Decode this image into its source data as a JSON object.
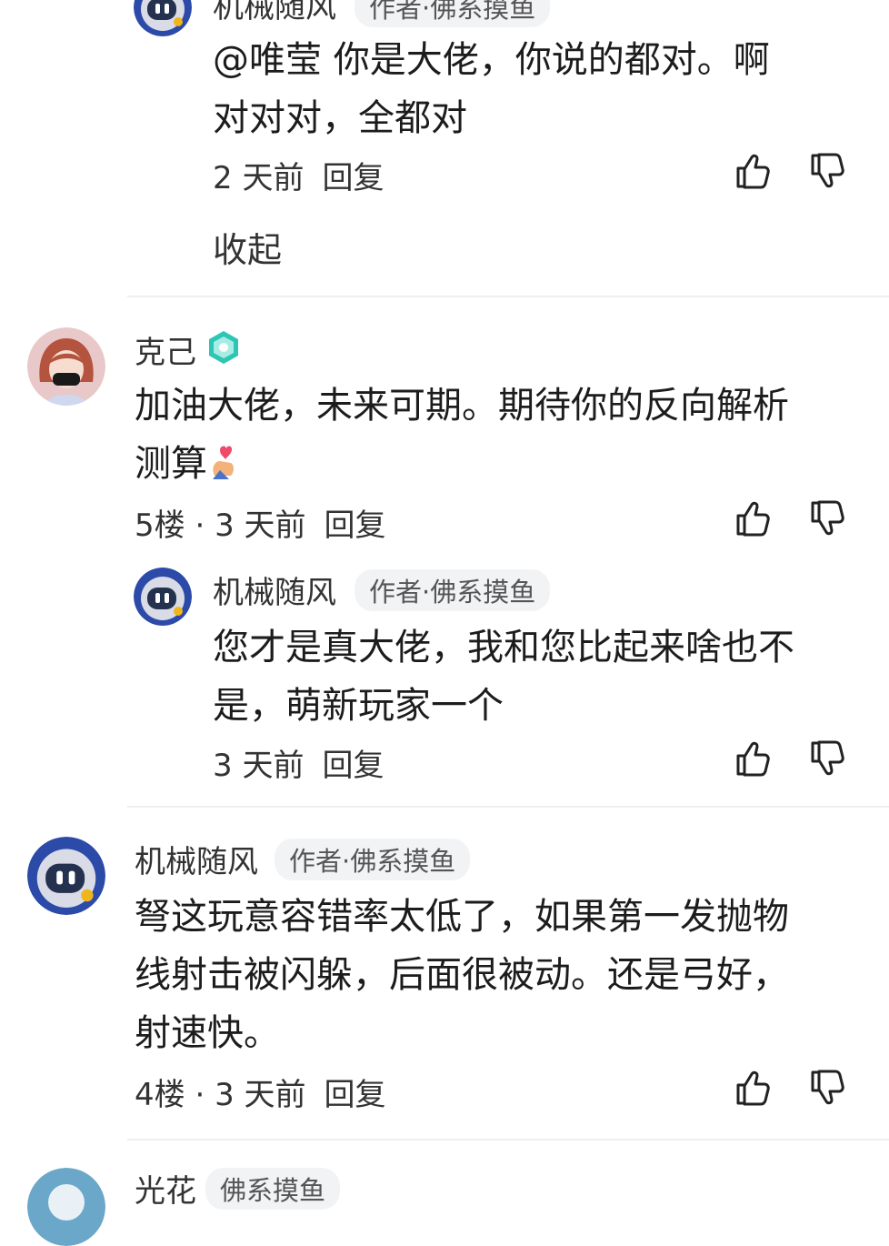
{
  "comments": [
    {
      "reply_top": {
        "author": "机械随风",
        "badge": "作者·佛系摸鱼",
        "text_line1": "@唯莹  你是大佬，你说的都对。啊",
        "text_line2": "对对对，全都对",
        "time": "2 天前",
        "reply_label": "回复"
      },
      "collapse_label": "收起"
    },
    {
      "author": "克己",
      "text_line1": "加油大佬，未来可期。期待你的反向解析",
      "text_line2": "测算",
      "floor": "5楼",
      "time": "3 天前",
      "reply_label": "回复",
      "reply": {
        "author": "机械随风",
        "badge": "作者·佛系摸鱼",
        "text_line1": "您才是真大佬，我和您比起来啥也不",
        "text_line2": "是，萌新玩家一个",
        "time": "3 天前",
        "reply_label": "回复"
      }
    },
    {
      "author": "机械随风",
      "badge": "作者·佛系摸鱼",
      "text_line1": "弩这玩意容错率太低了，如果第一发抛物",
      "text_line2": "线射击被闪躲，后面很被动。还是弓好，",
      "text_line3": "射速快。",
      "floor": "4楼",
      "time": "3 天前",
      "reply_label": "回复"
    },
    {
      "author": "光花",
      "badge": "佛系摸鱼"
    }
  ],
  "separator": " · ",
  "icons": {
    "like": "thumbs-up-icon",
    "dislike": "thumbs-down-icon"
  },
  "colors": {
    "avatar_blue": "#2c4aa8",
    "badge_bg": "#f2f3f5",
    "divider": "#efefef"
  }
}
